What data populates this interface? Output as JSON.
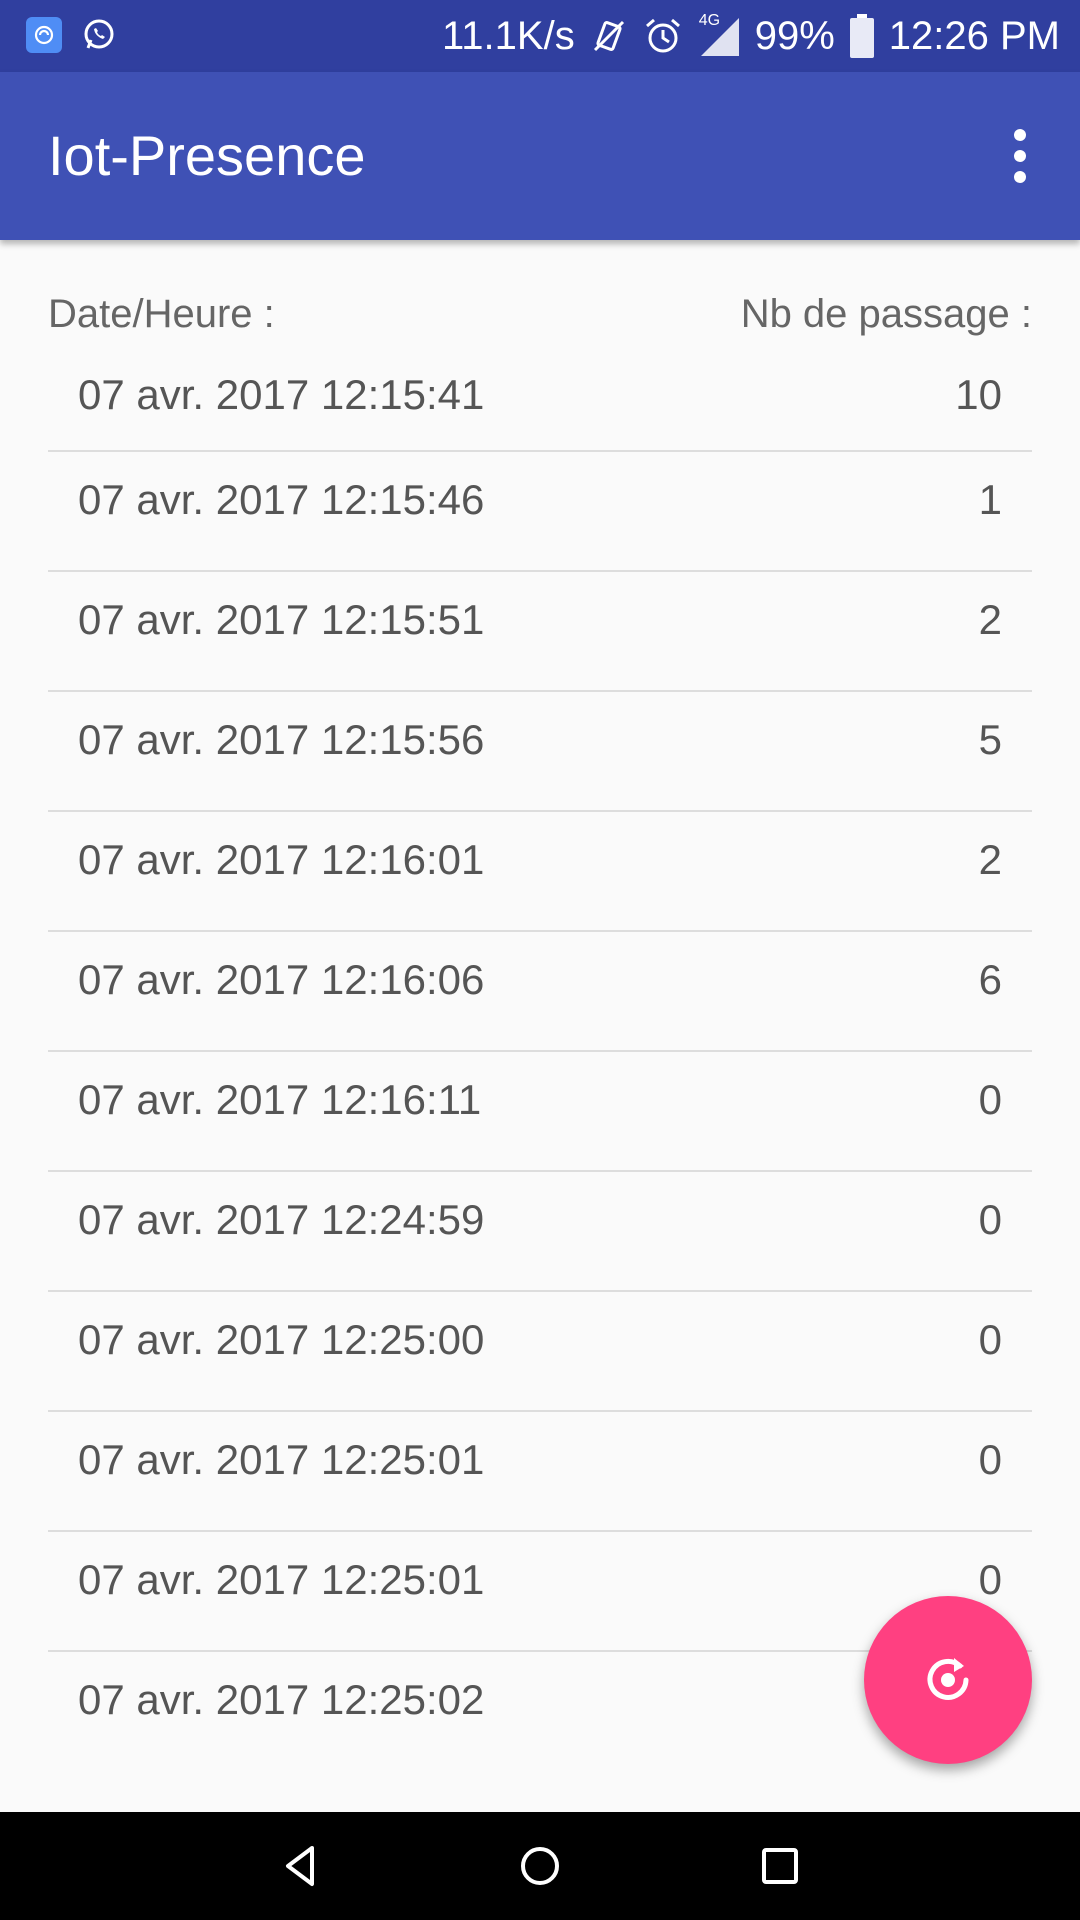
{
  "status_bar": {
    "speed": "11.1K/s",
    "network_type": "4G",
    "battery": "99%",
    "time": "12:26 PM",
    "icons": [
      "app-notification-icon",
      "whatsapp-icon",
      "vibrate-off-icon",
      "alarm-icon",
      "signal-icon",
      "battery-icon"
    ]
  },
  "app_bar": {
    "title": "Iot-Presence",
    "overflow_icon": "more-vert-icon"
  },
  "list_header": {
    "date_label": "Date/Heure :",
    "count_label": "Nb de passage :"
  },
  "rows": [
    {
      "date": "07 avr. 2017 12:15:41",
      "count": "10"
    },
    {
      "date": "07 avr. 2017 12:15:46",
      "count": "1"
    },
    {
      "date": "07 avr. 2017 12:15:51",
      "count": "2"
    },
    {
      "date": "07 avr. 2017 12:15:56",
      "count": "5"
    },
    {
      "date": "07 avr. 2017 12:16:01",
      "count": "2"
    },
    {
      "date": "07 avr. 2017 12:16:06",
      "count": "6"
    },
    {
      "date": "07 avr. 2017 12:16:11",
      "count": "0"
    },
    {
      "date": "07 avr. 2017 12:24:59",
      "count": "0"
    },
    {
      "date": "07 avr. 2017 12:25:00",
      "count": "0"
    },
    {
      "date": "07 avr. 2017 12:25:01",
      "count": "0"
    },
    {
      "date": "07 avr. 2017 12:25:01",
      "count": "0"
    },
    {
      "date": "07 avr. 2017 12:25:02",
      "count": ""
    }
  ],
  "fab": {
    "icon": "refresh-icon"
  },
  "nav_bar": {
    "icons": [
      "back-icon",
      "home-icon",
      "recents-icon"
    ]
  },
  "colors": {
    "status_bar": "#303F9F",
    "app_bar": "#3F51B5",
    "fab": "#FF4081",
    "background": "#FAFAFA",
    "text": "#555555"
  }
}
